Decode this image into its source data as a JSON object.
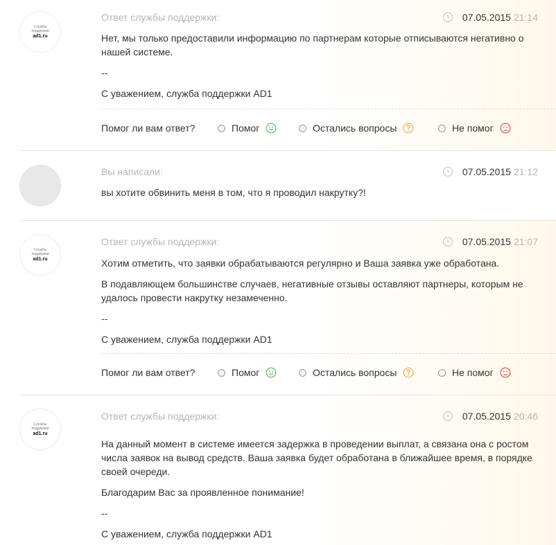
{
  "feedback": {
    "question": "Помог ли вам ответ?",
    "options": [
      {
        "label": "Помог",
        "icon": "smile-icon",
        "color": "#5cb85c"
      },
      {
        "label": "Остались вопросы",
        "icon": "question-icon",
        "color": "#f0ad4e"
      },
      {
        "label": "Не помог",
        "icon": "frown-icon",
        "color": "#d9534f"
      }
    ]
  },
  "avatar_text": {
    "line1": "Службы",
    "line2": "поддержки",
    "brand": "ad1.ru"
  },
  "messages": [
    {
      "author": "Ответ службы поддержки:",
      "date": "07.05.2015",
      "time": "21:14",
      "paragraphs": [
        "Нет, мы только предоставили информацию по партнерам которые отписываются негативно о нашей системе.",
        "--",
        "С уважением, служба поддержки AD1"
      ]
    },
    {
      "author": "Вы написали:",
      "date": "07.05.2015",
      "time": "21:12",
      "paragraphs": [
        "вы хотите обвинить меня в том, что я проводил накрутку?!"
      ]
    },
    {
      "author": "Ответ службы поддержки:",
      "date": "07.05.2015",
      "time": "21:07",
      "paragraphs": [
        "Хотим отметить, что заявки обрабатываются регулярно и Ваша заявка уже обработана.",
        "В подавляющем большинстве случаев, негативные отзывы оставляют партнеры, которым не удалось провести накрутку незамеченно.",
        "--",
        "С уважением, служба поддержки AD1"
      ]
    },
    {
      "author": "Ответ службы поддержки:",
      "date": "07.05.2015",
      "time": "20:46",
      "paragraphs": [
        "На данный момент в системе имеется задержка в проведении выплат, а связана она с ростом числа заявок на вывод средств. Ваша заявка будет обработана в ближайшее время, в порядке своей очереди.",
        "Благодарим Вас за проявленное понимание!",
        "--",
        "С уважением, служба поддержки AD1"
      ]
    }
  ]
}
